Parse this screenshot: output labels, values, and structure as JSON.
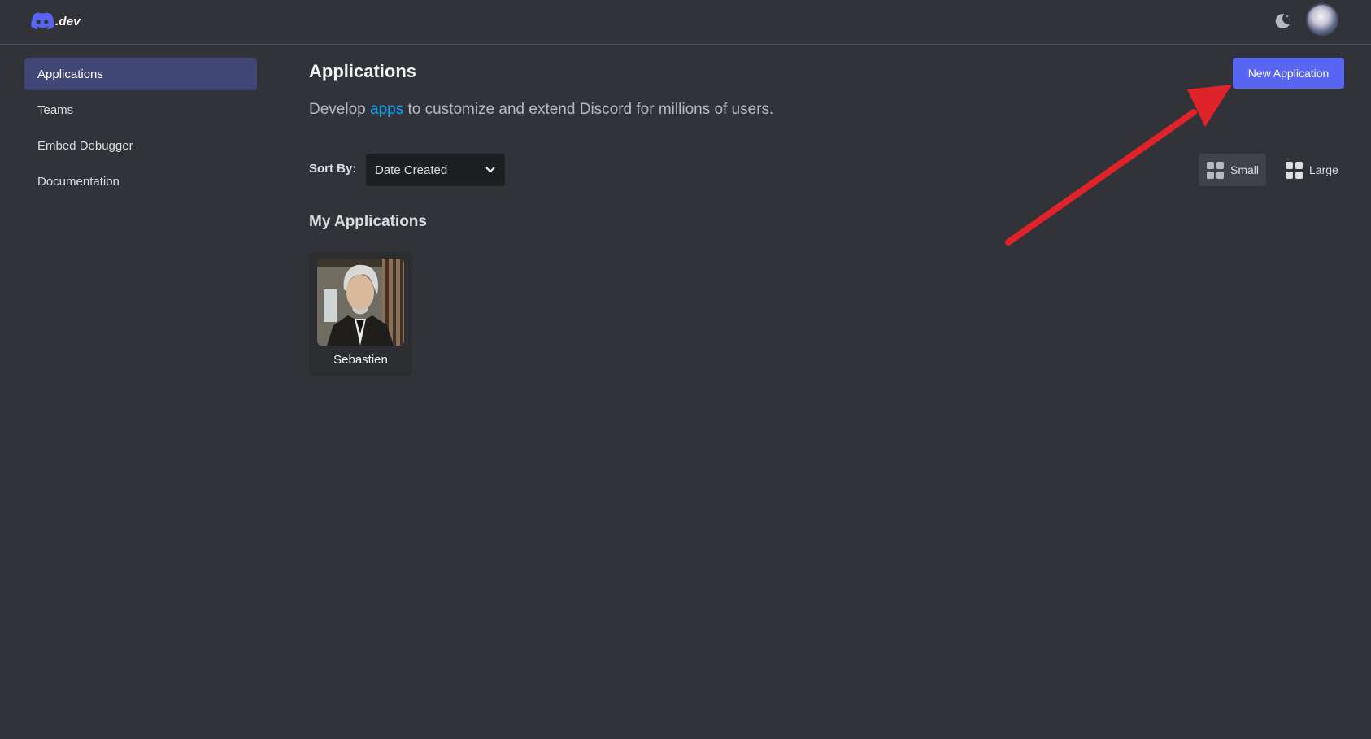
{
  "header": {
    "logo_text": ".dev",
    "logo_icon": "discord-logo-icon",
    "theme_toggle_icon": "moon-stars-icon",
    "avatar_icon": "user-avatar"
  },
  "sidebar": {
    "items": [
      {
        "label": "Applications",
        "active": true
      },
      {
        "label": "Teams",
        "active": false
      },
      {
        "label": "Embed Debugger",
        "active": false
      },
      {
        "label": "Documentation",
        "active": false
      }
    ]
  },
  "main": {
    "title": "Applications",
    "subtitle_prefix": "Develop ",
    "subtitle_link": "apps",
    "subtitle_suffix": " to customize and extend Discord for millions of users.",
    "new_app_button": "New Application",
    "sort": {
      "label": "Sort By:",
      "selected": "Date Created"
    },
    "view_options": {
      "small": "Small",
      "large": "Large",
      "selected": "Small"
    },
    "section_title": "My Applications",
    "applications": [
      {
        "name": "Sebastien",
        "icon": "app-portrait-icon"
      }
    ]
  },
  "colors": {
    "background": "#313338",
    "accent": "#5865f2",
    "link": "#00a8fc",
    "annotation_arrow": "#e0232a"
  }
}
